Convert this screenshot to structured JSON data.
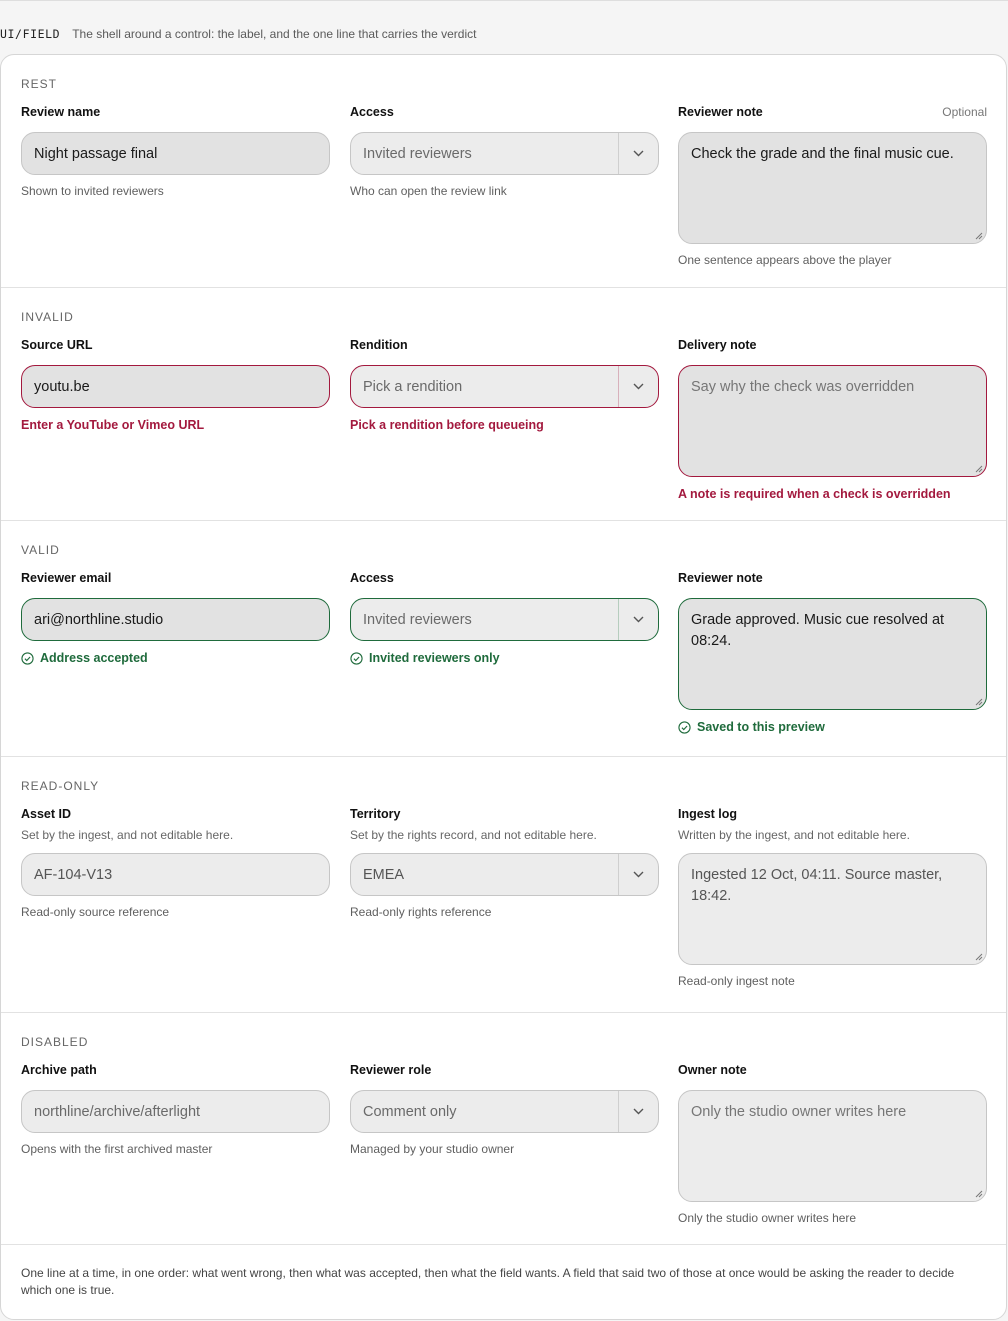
{
  "header": {
    "tag": "UI/FIELD",
    "description": "The shell around a control: the label, and the one line that carries the verdict"
  },
  "sections": {
    "rest": {
      "title": "REST",
      "f1": {
        "label": "Review name",
        "value": "Night passage final",
        "help": "Shown to invited reviewers"
      },
      "f2": {
        "label": "Access",
        "value": "Invited reviewers",
        "help": "Who can open the review link"
      },
      "f3": {
        "label": "Reviewer note",
        "optional": "Optional",
        "value": "Check the grade and the final music cue.",
        "help": "One sentence appears above the player"
      }
    },
    "invalid": {
      "title": "INVALID",
      "f1": {
        "label": "Source URL",
        "value": "youtu.be",
        "error": "Enter a YouTube or Vimeo URL"
      },
      "f2": {
        "label": "Rendition",
        "placeholder": "Pick a rendition",
        "error": "Pick a rendition before queueing"
      },
      "f3": {
        "label": "Delivery note",
        "placeholder": "Say why the check was overridden",
        "error": "A note is required when a check is overridden"
      }
    },
    "valid": {
      "title": "VALID",
      "f1": {
        "label": "Reviewer email",
        "value": "ari@northline.studio",
        "success": "Address accepted"
      },
      "f2": {
        "label": "Access",
        "value": "Invited reviewers",
        "success": "Invited reviewers only"
      },
      "f3": {
        "label": "Reviewer note",
        "value": "Grade approved. Music cue resolved at 08:24.",
        "success": "Saved to this preview"
      }
    },
    "readonly": {
      "title": "READ-ONLY",
      "f1": {
        "label": "Asset ID",
        "sub": "Set by the ingest, and not editable here.",
        "value": "AF-104-V13",
        "help": "Read-only source reference"
      },
      "f2": {
        "label": "Territory",
        "sub": "Set by the rights record, and not editable here.",
        "value": "EMEA",
        "help": "Read-only rights reference"
      },
      "f3": {
        "label": "Ingest log",
        "sub": "Written by the ingest, and not editable here.",
        "value": "Ingested 12 Oct, 04:11. Source master, 18:42.",
        "help": "Read-only ingest note"
      }
    },
    "disabled": {
      "title": "DISABLED",
      "f1": {
        "label": "Archive path",
        "value": "northline/archive/afterlight",
        "help": "Opens with the first archived master"
      },
      "f2": {
        "label": "Reviewer role",
        "value": "Comment only",
        "help": "Managed by your studio owner"
      },
      "f3": {
        "label": "Owner note",
        "placeholder": "Only the studio owner writes here",
        "help": "Only the studio owner writes here"
      }
    }
  },
  "footer": "One line at a time, in one order: what went wrong, then what was accepted, then what the field wants. A field that said two of those at once would be asking the reader to decide which one is true.",
  "colors": {
    "error": "#a3193e",
    "success": "#1f6b3c",
    "field_bg": "#e2e2e2"
  },
  "icons": {
    "select": "chevron-down-icon",
    "success": "check-circle-icon",
    "textarea": "resize-grip-icon"
  }
}
